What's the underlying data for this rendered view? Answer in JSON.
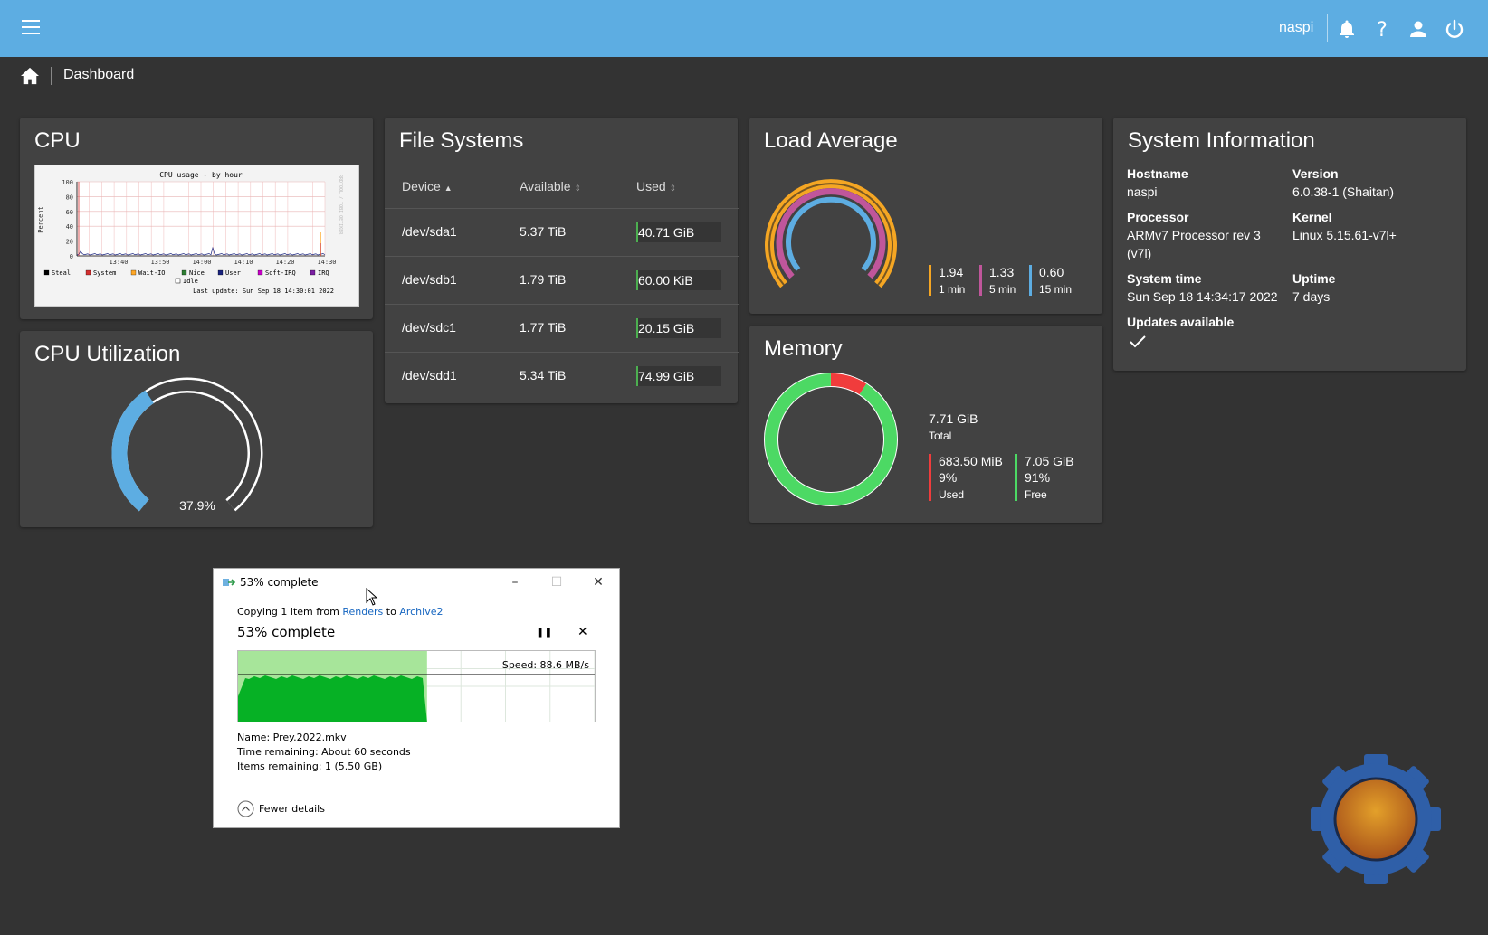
{
  "topbar": {
    "menu_icon": "hamburger-menu-icon",
    "username": "naspi",
    "icons": [
      "bell-icon",
      "help-icon",
      "user-icon",
      "power-icon"
    ]
  },
  "breadcrumb": {
    "home_icon": "home-icon",
    "title": "Dashboard"
  },
  "cpu_widget": {
    "title": "CPU",
    "graph": {
      "title": "CPU usage - by hour",
      "ylabel": "Percent",
      "yticks": [
        "100",
        "80",
        "60",
        "40",
        "20",
        "0"
      ],
      "xticks": [
        "13:40",
        "13:50",
        "14:00",
        "14:10",
        "14:20",
        "14:30"
      ],
      "side_text": "RRDTOOL / TOBI OETIKER",
      "legend": [
        {
          "name": "Steal",
          "color": "#000000"
        },
        {
          "name": "System",
          "color": "#d32f2f"
        },
        {
          "name": "Wait-IO",
          "color": "#ffa726"
        },
        {
          "name": "Nice",
          "color": "#2e7d32"
        },
        {
          "name": "User",
          "color": "#1a237e"
        },
        {
          "name": "Soft-IRQ",
          "color": "#c600c6"
        },
        {
          "name": "IRQ",
          "color": "#7b1fa2"
        },
        {
          "name": "Idle",
          "color": "#ffffff"
        }
      ],
      "last_update": "Last update: Sun Sep 18 14:30:01 2022"
    }
  },
  "cpu_util": {
    "title": "CPU Utilization",
    "value_label": "37.9%",
    "fraction": 0.379,
    "color": "#5dade2"
  },
  "filesystems": {
    "title": "File Systems",
    "columns": {
      "device": "Device",
      "available": "Available",
      "used": "Used"
    },
    "rows": [
      {
        "device": "/dev/sda1",
        "available": "5.37 TiB",
        "used": "40.71 GiB"
      },
      {
        "device": "/dev/sdb1",
        "available": "1.79 TiB",
        "used": "60.00 KiB"
      },
      {
        "device": "/dev/sdc1",
        "available": "1.77 TiB",
        "used": "20.15 GiB"
      },
      {
        "device": "/dev/sdd1",
        "available": "5.34 TiB",
        "used": "74.99 GiB"
      }
    ]
  },
  "load": {
    "title": "Load Average",
    "items": [
      {
        "value": "1.94",
        "label": "1 min",
        "color": "#f5a623"
      },
      {
        "value": "1.33",
        "label": "5 min",
        "color": "#c0569b"
      },
      {
        "value": "0.60",
        "label": "15 min",
        "color": "#5dade2"
      }
    ]
  },
  "memory": {
    "title": "Memory",
    "total_value": "7.71 GiB",
    "total_label": "Total",
    "used": {
      "value": "683.50 MiB",
      "percent": "9%",
      "label": "Used",
      "color": "#f03c3c",
      "fraction": 0.09
    },
    "free": {
      "value": "7.05 GiB",
      "percent": "91%",
      "label": "Free",
      "color": "#4cd964"
    }
  },
  "sysinfo": {
    "title": "System Information",
    "hostname_label": "Hostname",
    "hostname": "naspi",
    "version_label": "Version",
    "version": "6.0.38-1 (Shaitan)",
    "processor_label": "Processor",
    "processor_1": "ARMv7 Processor rev 3",
    "processor_2": "(v7l)",
    "kernel_label": "Kernel",
    "kernel": "Linux 5.15.61-v7l+",
    "time_label": "System time",
    "time": "Sun Sep 18 14:34:17 2022",
    "uptime_label": "Uptime",
    "uptime": "7 days",
    "updates_label": "Updates available",
    "updates_icon": "checkmark-icon"
  },
  "copy_dialog": {
    "title": "53% complete",
    "copy_prefix": "Copying 1 item from ",
    "source": "Renders",
    "to": " to ",
    "dest": "Archive2",
    "progress_text": "53% complete",
    "progress": 0.53,
    "speed": "Speed: 88.6 MB/s",
    "name_line": "Name:  Prey.2022.mkv",
    "time_line": "Time remaining:  About 60 seconds",
    "items_line": "Items remaining:  1 (5.50 GB)",
    "fewer_details": "Fewer details"
  }
}
